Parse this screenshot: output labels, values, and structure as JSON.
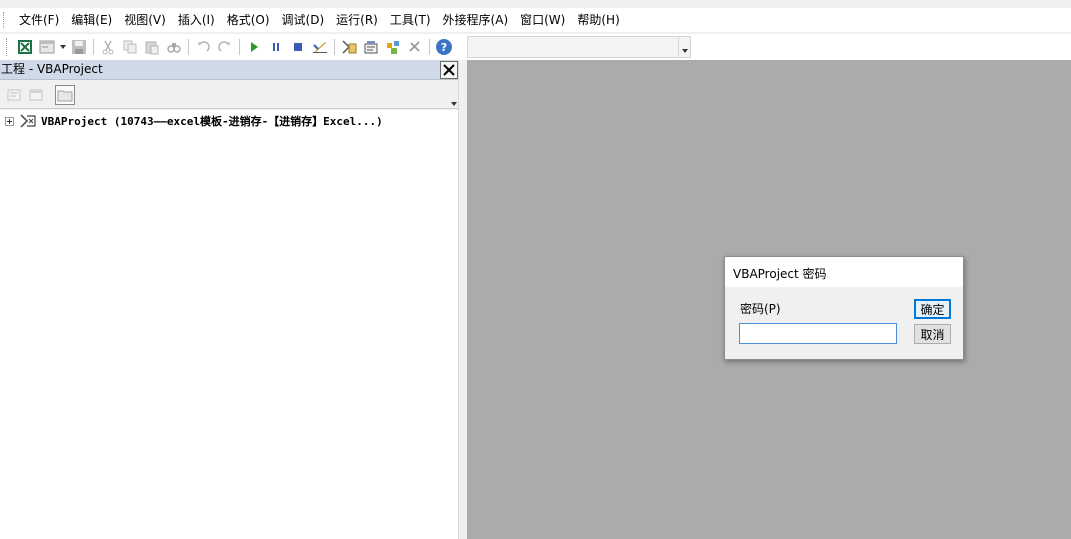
{
  "menubar": {
    "items": [
      {
        "label": "文件(F)"
      },
      {
        "label": "编辑(E)"
      },
      {
        "label": "视图(V)"
      },
      {
        "label": "插入(I)"
      },
      {
        "label": "格式(O)"
      },
      {
        "label": "调试(D)"
      },
      {
        "label": "运行(R)"
      },
      {
        "label": "工具(T)"
      },
      {
        "label": "外接程序(A)"
      },
      {
        "label": "窗口(W)"
      },
      {
        "label": "帮助(H)"
      }
    ]
  },
  "toolbar": {
    "icons": [
      "excel-view-icon",
      "insert-userform-icon",
      "save-icon",
      "cut-icon",
      "copy-icon",
      "paste-icon",
      "find-icon",
      "undo-icon",
      "redo-icon",
      "run-icon",
      "break-icon",
      "reset-icon",
      "design-mode-icon",
      "project-explorer-icon",
      "properties-icon",
      "object-browser-icon",
      "toolbox-icon",
      "help-icon"
    ],
    "combo_value": ""
  },
  "project_pane": {
    "title": "工程 - VBAProject",
    "tree": {
      "root_label": "VBAProject (10743——excel模板-进销存-【进销存】Excel...)"
    }
  },
  "dialog": {
    "title": "VBAProject 密码",
    "password_label": "密码(P)",
    "password_value": "",
    "ok_label": "确定",
    "cancel_label": "取消"
  },
  "colors": {
    "workspace_bg": "#ababab",
    "pane_title_bg": "#cfd9e8",
    "input_focus_border": "#4a90d9",
    "default_button_border": "#0078d7"
  }
}
